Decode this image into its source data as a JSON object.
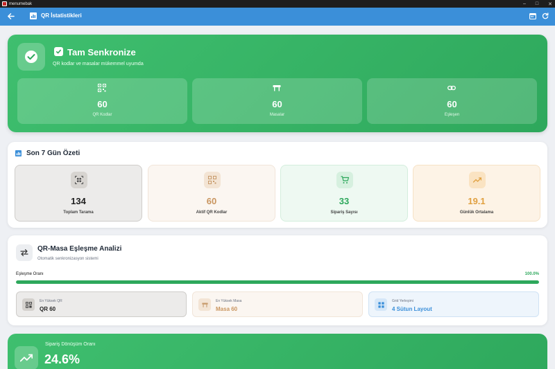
{
  "window": {
    "title": "menumebak"
  },
  "appbar": {
    "title": "QR İstatistikleri"
  },
  "sync": {
    "title": "Tam Senkronize",
    "subtitle": "QR kodlar ve masalar mükemmel uyumda",
    "stats": [
      {
        "icon": "qr-code-icon",
        "value": "60",
        "label": "QR Kodlar"
      },
      {
        "icon": "table-icon",
        "value": "60",
        "label": "Masalar"
      },
      {
        "icon": "link-icon",
        "value": "60",
        "label": "Eşleşen"
      }
    ]
  },
  "week": {
    "title": "Son 7 Gün Özeti",
    "cards": [
      {
        "icon": "qr-scan-icon",
        "value": "134",
        "label": "Toplam Tarama"
      },
      {
        "icon": "qr-code-icon",
        "value": "60",
        "label": "Aktif QR Kodlar"
      },
      {
        "icon": "cart-icon",
        "value": "33",
        "label": "Sipariş Sayısı"
      },
      {
        "icon": "trending-up-icon",
        "value": "19.1",
        "label": "Günlük Ortalama"
      }
    ]
  },
  "match": {
    "title": "QR-Masa Eşleşme Analizi",
    "subtitle": "Otomatik senkronizasyon sistemi",
    "rate_label": "Eşleşme Oranı",
    "rate_value": "100.0%",
    "rate_fraction": 1.0,
    "cards": [
      {
        "icon": "qr-code-icon",
        "key": "En Yüksek QR",
        "value": "QR 60"
      },
      {
        "icon": "table-icon",
        "key": "En Yüksek Masa",
        "value": "Masa 60"
      },
      {
        "icon": "grid-icon",
        "key": "Grid Yerleşimi",
        "value": "4 Sütun Layout"
      }
    ]
  },
  "conversion": {
    "label": "Sipariş Dönüşüm Oranı",
    "value": "24.6%"
  },
  "colors": {
    "appbar": "#3b8fd9",
    "green": "#2ea85c",
    "orange": "#e0a040"
  }
}
